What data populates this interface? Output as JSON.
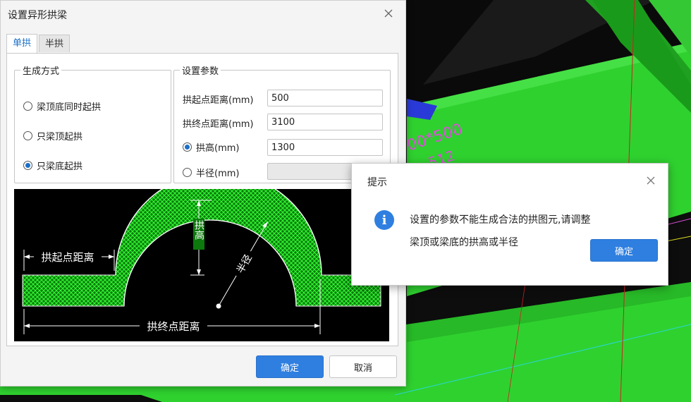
{
  "background": {
    "dimension_text": "00*500",
    "dimension_text2": "512",
    "colors": {
      "beam": "#2fd12f",
      "beam_dark": "#20a020",
      "floor": "#0d0d0d",
      "label": "#d84fd8"
    }
  },
  "main_dialog": {
    "title": "设置异形拱梁",
    "tabs": [
      {
        "label": "单拱",
        "active": true
      },
      {
        "label": "半拱",
        "active": false
      }
    ],
    "generation": {
      "legend": "生成方式",
      "options": [
        {
          "label": "梁顶底同时起拱",
          "checked": false
        },
        {
          "label": "只梁顶起拱",
          "checked": false
        },
        {
          "label": "只梁底起拱",
          "checked": true
        }
      ]
    },
    "params": {
      "legend": "设置参数",
      "start_distance": {
        "label": "拱起点距离(mm)",
        "value": "500"
      },
      "end_distance": {
        "label": "拱终点距离(mm)",
        "value": "3100"
      },
      "arch_height": {
        "label": "拱高(mm)",
        "value": "1300",
        "checked": true
      },
      "radius": {
        "label": "半径(mm)",
        "value": "",
        "checked": false
      }
    },
    "diagram": {
      "label_start": "拱起点距离",
      "label_end": "拱终点距离",
      "label_height": "拱高",
      "label_radius": "半径",
      "fill_color": "#1fbf1f"
    },
    "ok_label": "确定",
    "cancel_label": "取消"
  },
  "prompt_dialog": {
    "title": "提示",
    "message_line1": "设置的参数不能生成合法的拱图元,请调整",
    "message_line2": "梁顶或梁底的拱高或半径",
    "ok_label": "确定",
    "icon": "info-icon",
    "accent": "#2f7fe0"
  }
}
